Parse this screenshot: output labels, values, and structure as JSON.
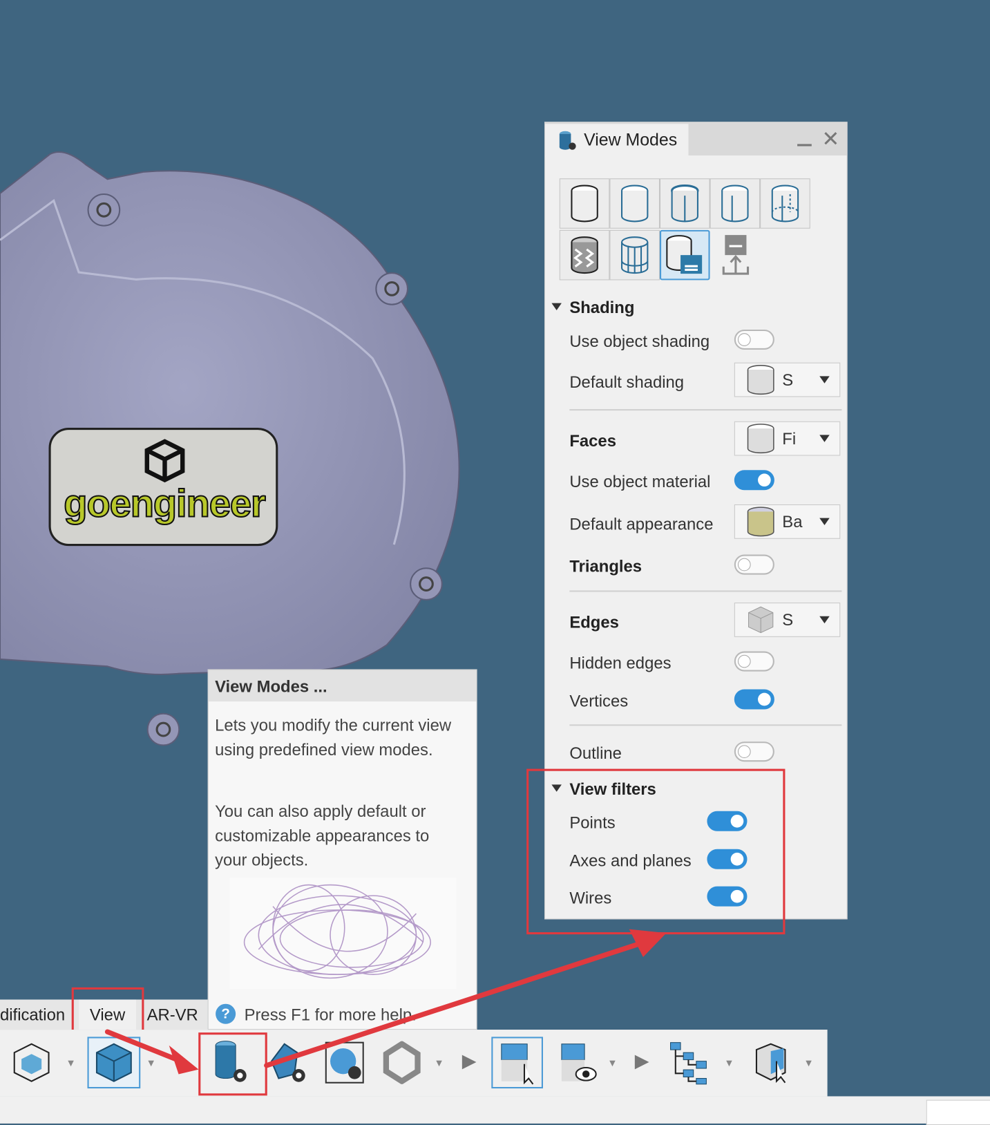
{
  "viewport": {
    "logo_text": "goengineer"
  },
  "panel": {
    "title": "View Modes",
    "minimize_icon": "minimize-icon",
    "close_icon": "close-icon",
    "mode_icons": [
      "shaded",
      "shaded-blue-edges",
      "shaded-with-edges",
      "shaded-with-visible-edges",
      "shaded-with-hidden-edges",
      "wavy-shaded",
      "wireframe",
      "save-view-mode",
      "import-view-mode"
    ],
    "selected_mode_index": 7,
    "shading": {
      "header": "Shading",
      "use_object_shading": {
        "label": "Use object shading",
        "on": false
      },
      "default_shading": {
        "label": "Default shading",
        "value": "S"
      }
    },
    "faces": {
      "label": "Faces",
      "value": "Fi",
      "use_object_material": {
        "label": "Use object material",
        "on": true
      },
      "default_appearance": {
        "label": "Default appearance",
        "value": "Ba"
      },
      "triangles": {
        "label": "Triangles",
        "on": false
      }
    },
    "edges": {
      "label": "Edges",
      "value": "S",
      "hidden_edges": {
        "label": "Hidden edges",
        "on": false
      },
      "vertices": {
        "label": "Vertices",
        "on": true
      }
    },
    "outline": {
      "label": "Outline",
      "on": false
    },
    "view_filters": {
      "header": "View filters",
      "points": {
        "label": "Points",
        "on": true
      },
      "axes": {
        "label": "Axes and planes",
        "on": true
      },
      "wires": {
        "label": "Wires",
        "on": true
      }
    }
  },
  "tooltip": {
    "title": "View Modes ...",
    "p1": "Lets you modify the current view using predefined view modes.",
    "p2": "You can also apply default or customizable appearances to your objects.",
    "help": "Press F1 for more help."
  },
  "ribbon": {
    "tabs": [
      "dification",
      "View",
      "AR-VR"
    ],
    "active_tab": "View"
  },
  "toolbar": {
    "buttons": [
      "isometric-view",
      "shaded-cube",
      "view-modes",
      "render-settings",
      "environment-settings",
      "rendering-options",
      "selection-mode",
      "visibility-mode",
      "tree-structure",
      "cube-select"
    ]
  },
  "colors": {
    "background": "#3f6580",
    "toggle_on": "#2f8fd8",
    "highlight": "#e0393e"
  }
}
